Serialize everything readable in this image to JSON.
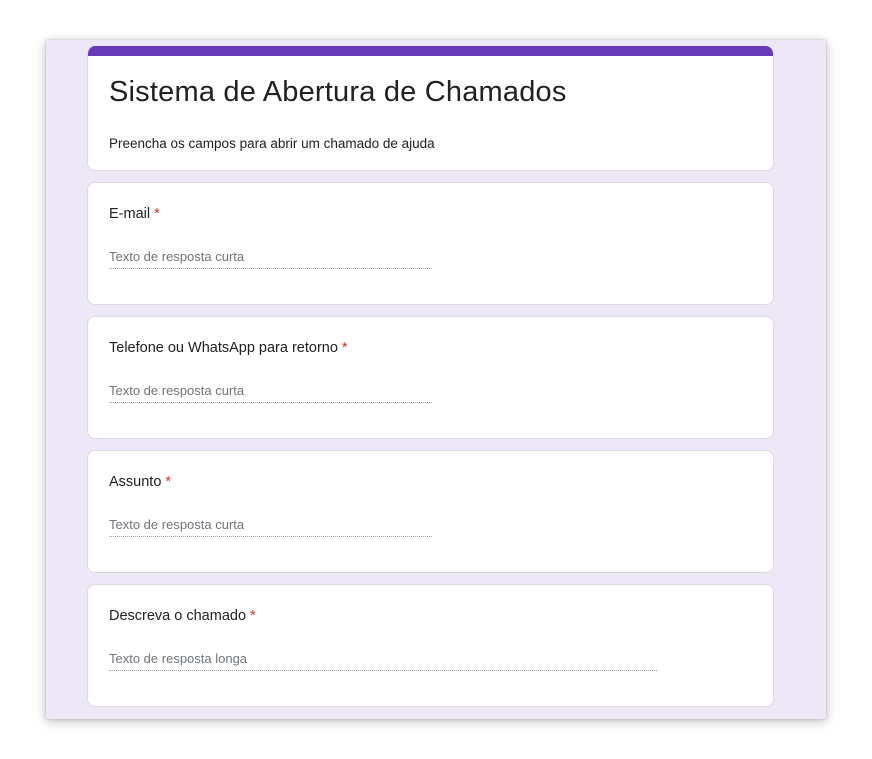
{
  "form": {
    "title": "Sistema de Abertura de Chamados",
    "description": "Preencha os campos para abrir um chamado de ajuda",
    "accent_color": "#673ab7",
    "background_color": "#ede7f8",
    "required_marker": "*",
    "required_color": "#d93025"
  },
  "questions": [
    {
      "label": "E-mail",
      "required": true,
      "type": "short",
      "placeholder": "Texto de resposta curta",
      "value": ""
    },
    {
      "label": "Telefone ou WhatsApp para retorno",
      "required": true,
      "type": "short",
      "placeholder": "Texto de resposta curta",
      "value": ""
    },
    {
      "label": "Assunto",
      "required": true,
      "type": "short",
      "placeholder": "Texto de resposta curta",
      "value": ""
    },
    {
      "label": "Descreva o chamado",
      "required": true,
      "type": "long",
      "placeholder": "Texto de resposta longa",
      "value": ""
    }
  ]
}
